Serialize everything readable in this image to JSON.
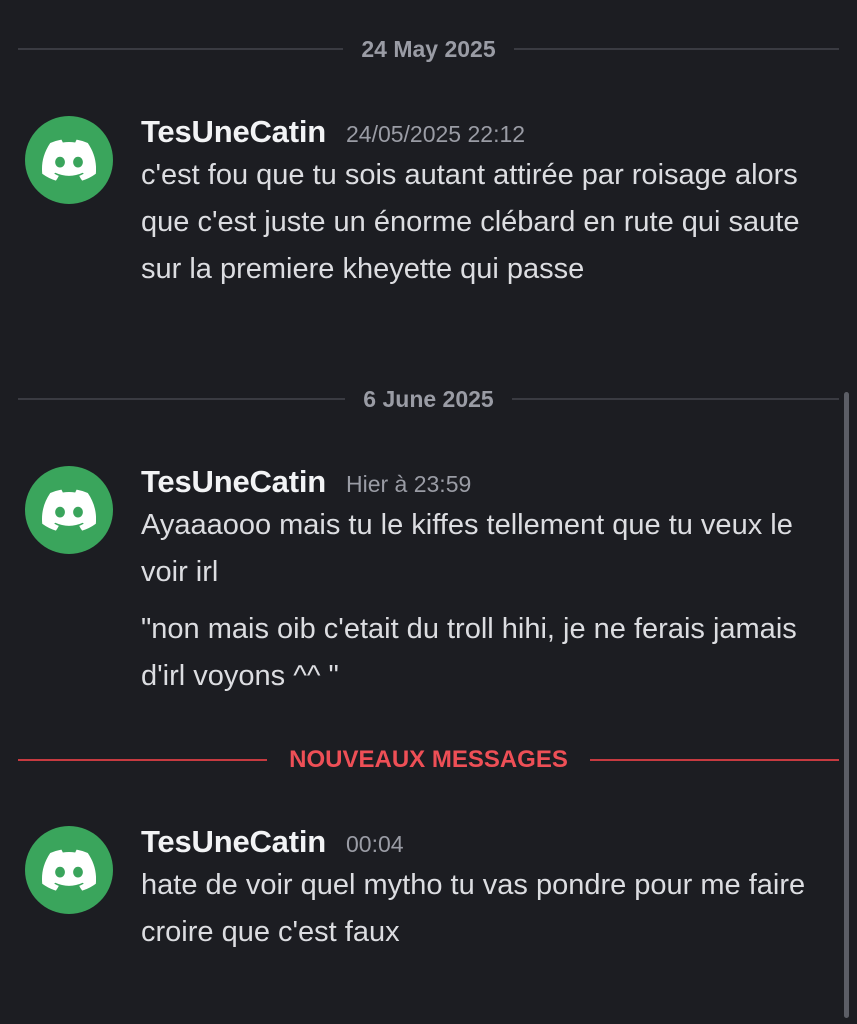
{
  "dividers": {
    "first": "24 May 2025",
    "second": "6 June 2025",
    "new_messages": "NOUVEAUX MESSAGES"
  },
  "messages": [
    {
      "username": "TesUneCatin",
      "timestamp": "24/05/2025 22:12",
      "avatar_icon": "discord-logo-icon",
      "texts": [
        "c'est fou que tu sois autant attirée par roisage alors que c'est juste un énorme clébard en rute qui saute sur la premiere kheyette qui passe"
      ]
    },
    {
      "username": "TesUneCatin",
      "timestamp": "Hier à 23:59",
      "avatar_icon": "discord-logo-icon",
      "texts": [
        "Ayaaaooo mais tu le kiffes tellement que tu veux le voir irl",
        "\"non mais oib c'etait du troll hihi, je ne ferais jamais d'irl voyons ^^ \""
      ]
    },
    {
      "username": "TesUneCatin",
      "timestamp": "00:04",
      "avatar_icon": "discord-logo-icon",
      "texts": [
        "hate de voir quel mytho tu vas pondre pour me faire croire que c'est faux"
      ]
    }
  ],
  "colors": {
    "background": "#1c1d22",
    "avatar": "#3aa55c",
    "new_messages": "#ee4f56"
  }
}
